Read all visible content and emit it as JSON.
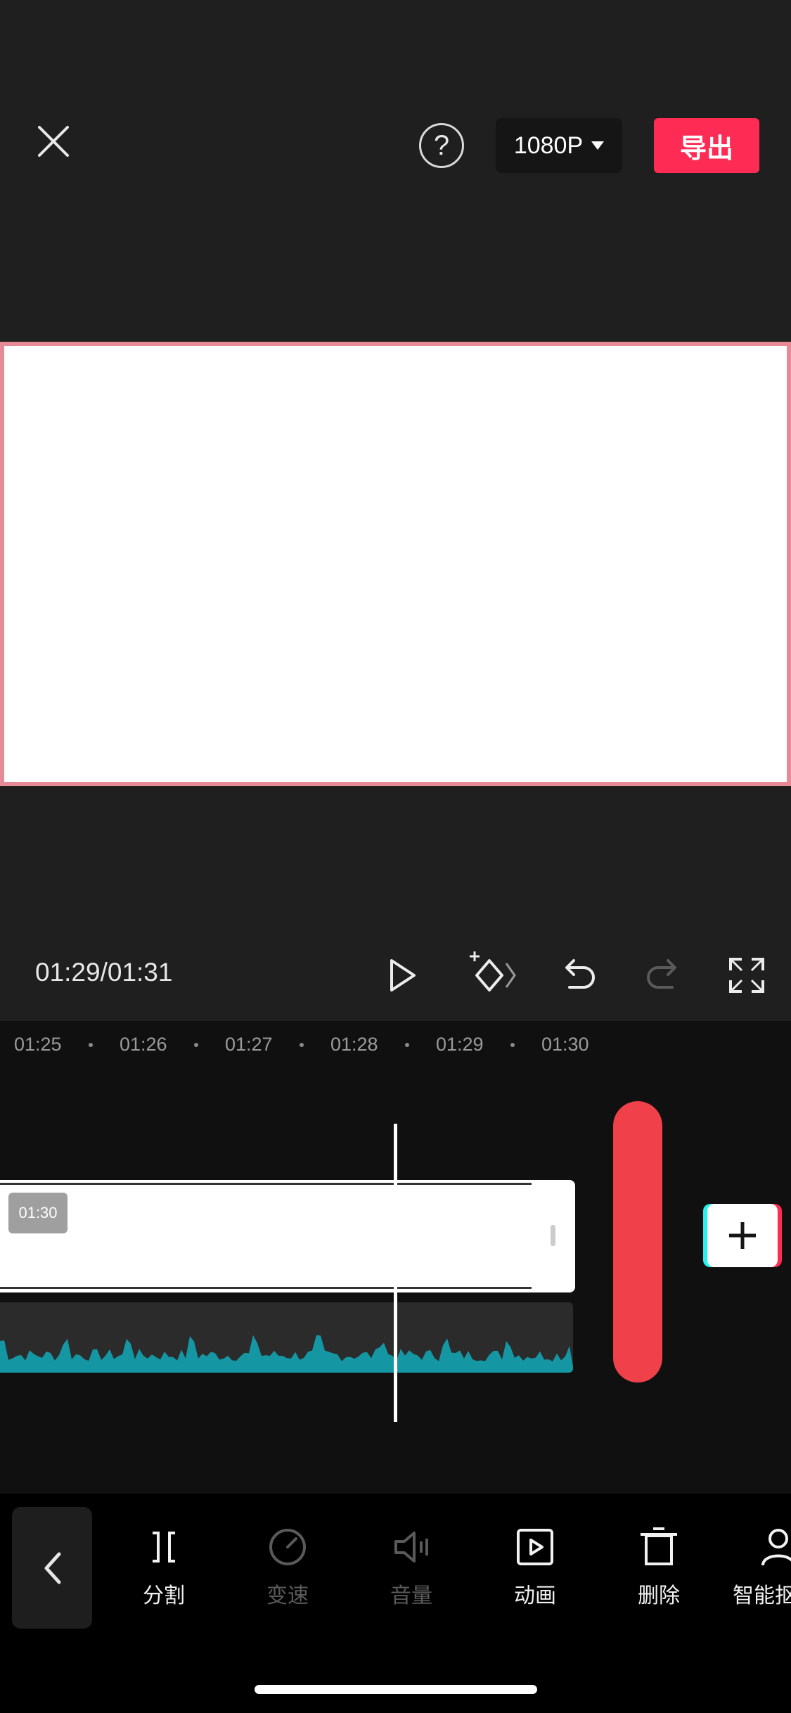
{
  "top_bar": {
    "help_glyph": "?",
    "resolution_label": "1080P",
    "export_label": "导出"
  },
  "player": {
    "timecode": "01:29/01:31"
  },
  "timeline": {
    "ruler": [
      "01:25",
      "01:26",
      "01:27",
      "01:28",
      "01:29",
      "01:30"
    ],
    "clip_duration": "01:30",
    "colors": {
      "waveform": "#1596a3",
      "marker": "#f0414a",
      "accent": "#fe2c55"
    }
  },
  "toolbar": {
    "items": [
      {
        "label": "分割",
        "icon": "split-icon",
        "enabled": true
      },
      {
        "label": "变速",
        "icon": "speed-icon",
        "enabled": false
      },
      {
        "label": "音量",
        "icon": "volume-icon",
        "enabled": false
      },
      {
        "label": "动画",
        "icon": "animation-icon",
        "enabled": true
      },
      {
        "label": "删除",
        "icon": "delete-icon",
        "enabled": true
      },
      {
        "label": "智能抠",
        "icon": "smart-cutout-icon",
        "enabled": true
      }
    ]
  }
}
